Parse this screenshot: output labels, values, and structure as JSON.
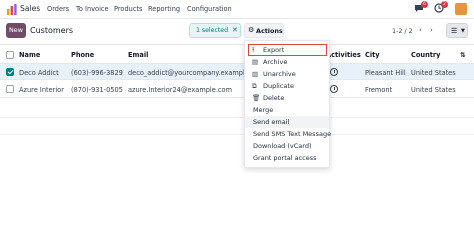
{
  "navbar": {
    "app_name": "Sales",
    "menu": [
      "Orders",
      "To Invoice",
      "Products",
      "Reporting",
      "Configuration"
    ],
    "messages_count": "6",
    "activities_count": "2"
  },
  "control": {
    "new_label": "New",
    "title": "Customers",
    "selected_label": "1 selected",
    "actions_label": "Actions",
    "pager": "1-2 / 2"
  },
  "table": {
    "headers": {
      "name": "Name",
      "phone": "Phone",
      "email": "Email",
      "activities": "Activities",
      "city": "City",
      "country": "Country"
    },
    "rows": [
      {
        "name": "Deco Addict",
        "phone": "(603)-996-3829",
        "email": "deco_addict@yourcompany.example.com",
        "city": "Pleasant Hill",
        "country": "United States",
        "selected": true
      },
      {
        "name": "Azure Interior",
        "phone": "(870)-931-0505",
        "email": "azure.Interior24@example.com",
        "city": "Fremont",
        "country": "United States",
        "selected": false
      }
    ]
  },
  "dropdown": {
    "items": [
      "Export",
      "Archive",
      "Unarchive",
      "Duplicate",
      "Delete",
      "Merge",
      "Send email",
      "Send SMS Text Message",
      "Download (vCard)",
      "Grant portal access"
    ]
  },
  "colors": {
    "brand": "#714b67",
    "accent": "#017e84",
    "danger": "#dc3545",
    "selected_row": "#e8f1fa"
  }
}
